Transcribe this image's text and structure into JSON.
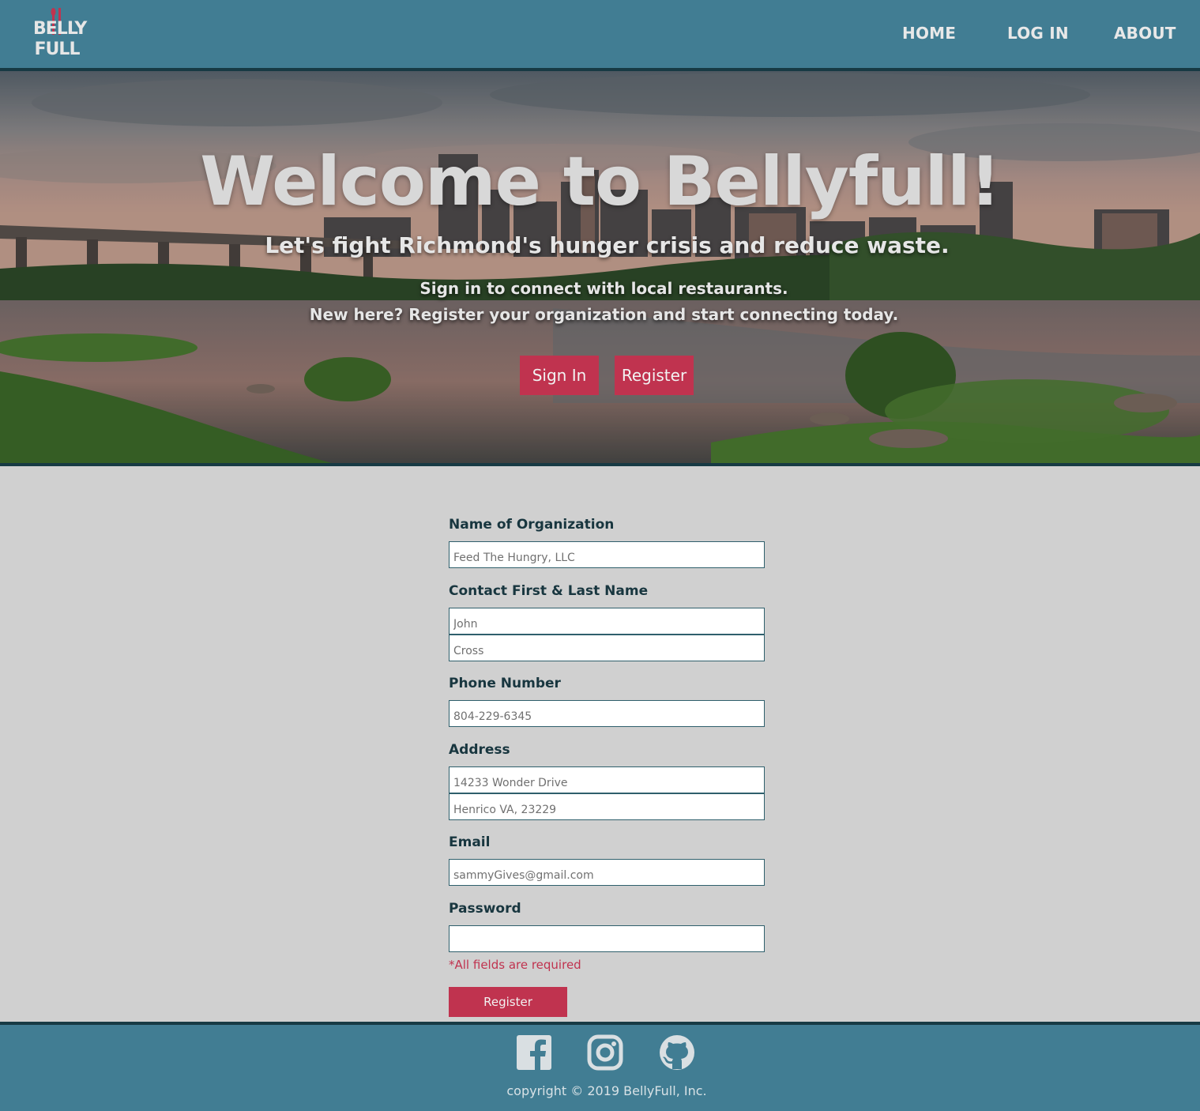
{
  "brand": {
    "logo_line1": "BELLY",
    "logo_line2": "FULL"
  },
  "nav": {
    "home": "HOME",
    "login": "LOG IN",
    "about": "ABOUT"
  },
  "hero": {
    "title": "Welcome to Bellyfull!",
    "subtitle": "Let's fight Richmond's hunger crisis and reduce waste.",
    "line1": "Sign in to connect with local restaurants.",
    "line2": "New here? Register your organization and start connecting today.",
    "sign_in_label": "Sign In",
    "register_label": "Register"
  },
  "form": {
    "org_label": "Name of Organization",
    "org_placeholder": "Feed The Hungry, LLC",
    "contact_label": "Contact First & Last Name",
    "first_placeholder": "John",
    "last_placeholder": "Cross",
    "phone_label": "Phone Number",
    "phone_placeholder": "804-229-6345",
    "address_label": "Address",
    "address1_placeholder": "14233 Wonder Drive",
    "address2_placeholder": "Henrico VA, 23229",
    "email_label": "Email",
    "email_placeholder": "sammyGives@gmail.com",
    "password_label": "Password",
    "password_placeholder": "",
    "required_note": "*All fields are required",
    "submit_label": "Register"
  },
  "footer": {
    "icons": [
      "facebook-icon",
      "instagram-icon",
      "github-icon"
    ],
    "copyright": "copyright © 2019 BellyFull, Inc."
  },
  "colors": {
    "nav_bg": "#417d93",
    "border": "#173a44",
    "accent": "#c0334f",
    "page_bg": "#d0d0d0",
    "label": "#18363f"
  }
}
